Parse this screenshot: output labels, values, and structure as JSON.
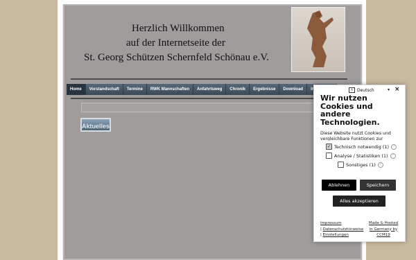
{
  "header": {
    "line1": "Herzlich Willkommen",
    "line2": "auf der Internetseite der",
    "line3": "St. Georg Schützen Schernfeld Schönau e.V."
  },
  "nav": {
    "items": [
      "Home",
      "Vorstandschaft",
      "Termine",
      "RWK Mannschaften",
      "Anfahrtsweg",
      "Chronik",
      "Ergebnisse",
      "Download",
      "Impressum"
    ]
  },
  "main": {
    "aktuelles_label": "Aktuelles"
  },
  "cookie": {
    "language": "Deutsch",
    "title": "Wir nutzen Cookies und andere Technologien.",
    "text": "Diese Website nutzt Cookies und vergleichbare Funktionen zur",
    "options": [
      {
        "label": "Technisch notwendig (1)",
        "checked": true
      },
      {
        "label": "Analyse / Statistiken (1)",
        "checked": false
      },
      {
        "label": "Sonstiges (1)",
        "checked": false
      }
    ],
    "decline_label": "Ablehnen",
    "save_label": "Speichern",
    "accept_all_label": "Alles akzeptieren",
    "footer": {
      "impressum": "Impressum",
      "datenschutz": "Datenschutzhinweise",
      "einstellungen": "Einstellungen",
      "made_hosted": "Made & Hosted",
      "made_in": "in Germany by",
      "ccm19": "CCM19"
    }
  }
}
